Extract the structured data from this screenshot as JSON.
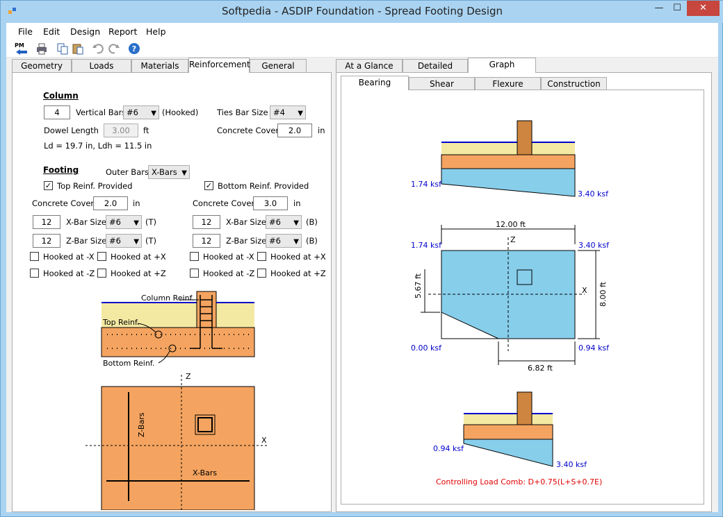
{
  "window": {
    "title": "Softpedia - ASDIP Foundation - Spread Footing Design",
    "minimize": "—",
    "maximize": "☐",
    "close": "✕"
  },
  "menu": [
    "File",
    "Edit",
    "Design",
    "Report",
    "Help"
  ],
  "toolbar": {
    "pm_label": "PM"
  },
  "left_tabs": [
    "Geometry",
    "Loads",
    "Materials",
    "Reinforcement",
    "General"
  ],
  "right_tabs": [
    "At a Glance",
    "Detailed",
    "Graph"
  ],
  "graph_tabs": [
    "Bearing",
    "Shear",
    "Flexure",
    "Construction"
  ],
  "column": {
    "heading": "Column",
    "vertical_bars_count": "4",
    "vertical_bars_label": "Vertical Bars",
    "vertical_bar_size": "#6",
    "hooked": "(Hooked)",
    "ties_label": "Ties Bar Size",
    "ties_size": "#4",
    "dowel_label": "Dowel Length",
    "dowel_value": "3.00",
    "dowel_unit": "ft",
    "cover_label": "Concrete Cover",
    "cover_value": "2.0",
    "cover_unit": "in",
    "ld_text": "Ld = 19.7 in,   Ldh = 11.5 in"
  },
  "footing": {
    "heading": "Footing",
    "outer_bars_label": "Outer Bars",
    "outer_bars_value": "X-Bars",
    "top": {
      "provided": "Top Reinf. Provided",
      "cover_label": "Concrete Cover",
      "cover": "2.0",
      "unit": "in",
      "x_count": "12",
      "x_label": "X-Bar Size",
      "x_size": "#6",
      "x_pos": "(T)",
      "z_count": "12",
      "z_label": "Z-Bar Size",
      "z_size": "#6",
      "z_pos": "(T)",
      "hook_nx": "Hooked at -X",
      "hook_px": "Hooked at +X",
      "hook_nz": "Hooked at -Z",
      "hook_pz": "Hooked at +Z"
    },
    "bottom": {
      "provided": "Bottom Reinf. Provided",
      "cover_label": "Concrete Cover",
      "cover": "3.0",
      "unit": "in",
      "x_count": "12",
      "x_label": "X-Bar Size",
      "x_size": "#6",
      "x_pos": "(B)",
      "z_count": "12",
      "z_label": "Z-Bar Size",
      "z_size": "#6",
      "z_pos": "(B)",
      "hook_nx": "Hooked at -X",
      "hook_px": "Hooked at +X",
      "hook_nz": "Hooked at -Z",
      "hook_pz": "Hooked at +Z"
    }
  },
  "section_diagram": {
    "column_reinf": "Column Reinf.",
    "top_reinf": "Top Reinf.",
    "bottom_reinf": "Bottom Reinf."
  },
  "plan_diagram": {
    "z": "Z",
    "x": "X",
    "zbars": "Z-Bars",
    "xbars": "X-Bars"
  },
  "bearing": {
    "top_left": "1.74 ksf",
    "top_right": "3.40 ksf",
    "plan_width": "12.00 ft",
    "plan_height": "8.00 ft",
    "plan_z": "Z",
    "plan_x": "X",
    "plan_left_dim": "5.67 ft",
    "plan_bottom_dim": "6.82 ft",
    "plan_tl": "1.74 ksf",
    "plan_tr": "3.40 ksf",
    "plan_bl": "0.00 ksf",
    "plan_br": "0.94 ksf",
    "bot_left": "0.94 ksf",
    "bot_right": "3.40 ksf",
    "controlling": "Controlling Load Comb: D+0.75(L+S+0.7E)"
  },
  "colors": {
    "soil": "#f3e9a3",
    "concrete": "#f4a460",
    "pressure": "#87ceeb",
    "column": "#cd853f",
    "grade_line": "#0000cc"
  }
}
